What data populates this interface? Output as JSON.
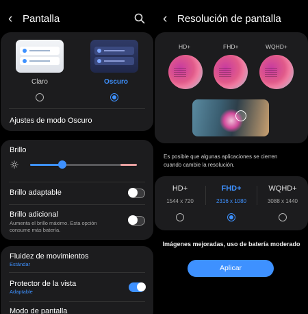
{
  "left": {
    "title": "Pantalla",
    "theme": {
      "light_label": "Claro",
      "dark_label": "Oscuro",
      "selected": "Oscuro",
      "dark_settings_label": "Ajustes de modo Oscuro"
    },
    "brightness": {
      "label": "Brillo",
      "level": 0.3,
      "adaptive_label": "Brillo adaptable",
      "adaptive_on": false,
      "extra_label": "Brillo adicional",
      "extra_desc_line1": "Aumenta el brillo máximo. Esta opción",
      "extra_desc_line2": "consume más batería.",
      "extra_on": false
    },
    "motion": {
      "label": "Fluidez de movimientos",
      "value": "Estándar"
    },
    "eye": {
      "label": "Protector de la vista",
      "value": "Adaptable",
      "on": true
    },
    "screen_mode": {
      "label": "Modo de pantalla"
    }
  },
  "right": {
    "title": "Resolución de pantalla",
    "preview_labels": [
      "HD+",
      "FHD+",
      "WQHD+"
    ],
    "note_line1": "Es posible que algunas aplicaciones se cierren",
    "note_line2": "cuando cambie la resolución.",
    "options": [
      {
        "name": "HD+",
        "res": "1544 x 720",
        "selected": false
      },
      {
        "name": "FHD+",
        "res": "2316 x 1080",
        "selected": true
      },
      {
        "name": "WQHD+",
        "res": "3088 x 1440",
        "selected": false
      }
    ],
    "summary": "Imágenes mejoradas, uso de batería moderado",
    "apply_label": "Aplicar"
  },
  "colors": {
    "accent": "#3e91ff",
    "card": "#1c1c1e",
    "background": "#000000"
  },
  "icons": [
    "back-arrow-icon",
    "search-icon",
    "sun-icon"
  ]
}
